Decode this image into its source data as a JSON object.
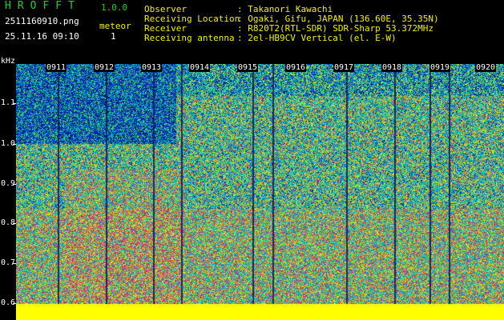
{
  "header": {
    "app_title": "HROFFT",
    "version": "1.0.0",
    "filename": "2511160910.png",
    "datetime": "25.11.16 09:10",
    "meteor_label": "meteor",
    "meteor_count": "1",
    "observer_label": "Observer",
    "observer_value": ": Takanori Kawachi",
    "location_label": "Receiving Location",
    "location_value": ": Ogaki, Gifu, JAPAN (136.60E, 35.35N)",
    "receiver_label": "Receiver",
    "receiver_value": ": R820T2(RTL-SDR) SDR-Sharp 53.372MHz",
    "antenna_label": "Receiving antenna",
    "antenna_value": ": 2el-HB9CV Vertical (el. E-W)"
  },
  "axis": {
    "unit": "kHz",
    "ticks": [
      "1.1",
      "1.0",
      "0.9",
      "0.8",
      "0.7",
      "0.6"
    ],
    "time_labels": [
      "0911",
      "0912",
      "0913",
      "0914",
      "0915",
      "0916",
      "0917",
      "0918",
      "0919",
      "0920"
    ]
  },
  "colors": {
    "header_green": "#1fd31f",
    "header_yellow": "#f2f200",
    "baseline_yellow": "#ffff00"
  }
}
